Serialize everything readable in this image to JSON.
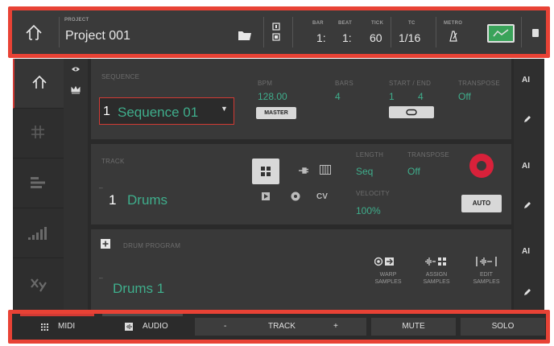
{
  "topbar": {
    "project_label": "PROJECT",
    "project_name": "Project 001",
    "bar_label": "BAR",
    "bar_value": "1:",
    "beat_label": "BEAT",
    "beat_value": "1:",
    "tick_label": "TICK",
    "tick_value": "60",
    "tc_label": "TC",
    "tc_value": "1/16",
    "metro_label": "METRO"
  },
  "sequence": {
    "label": "SEQUENCE",
    "number": "1",
    "name": "Sequence 01",
    "bpm_label": "BPM",
    "bpm_value": "128.00",
    "master_label": "MASTER",
    "bars_label": "BARS",
    "bars_value": "4",
    "startend_label": "START / END",
    "start_value": "1",
    "end_value": "4",
    "transpose_label": "TRANSPOSE",
    "transpose_value": "Off"
  },
  "track": {
    "label": "TRACK",
    "number": "1",
    "name": "Drums",
    "length_label": "LENGTH",
    "length_value": "Seq",
    "transpose_label": "TRANSPOSE",
    "transpose_value": "Off",
    "velocity_label": "VELOCITY",
    "velocity_value": "100%",
    "auto_label": "AUTO",
    "cv_label": "CV"
  },
  "program": {
    "label": "DRUM PROGRAM",
    "name": "Drums 1",
    "warp_label": "WARP\nSAMPLES",
    "assign_label": "ASSIGN\nSAMPLES",
    "edit_label": "EDIT\nSAMPLES"
  },
  "right_col": {
    "ai_label": "A"
  },
  "bottombar": {
    "midi_label": "MIDI",
    "audio_label": "AUDIO",
    "minus_label": "-",
    "track_label": "TRACK",
    "plus_label": "+",
    "mute_label": "MUTE",
    "solo_label": "SOLO"
  },
  "colors": {
    "highlight": "#e84235",
    "value_green": "#3fae8c",
    "record_red": "#d8213a",
    "metronome_green": "#3aa35a"
  }
}
